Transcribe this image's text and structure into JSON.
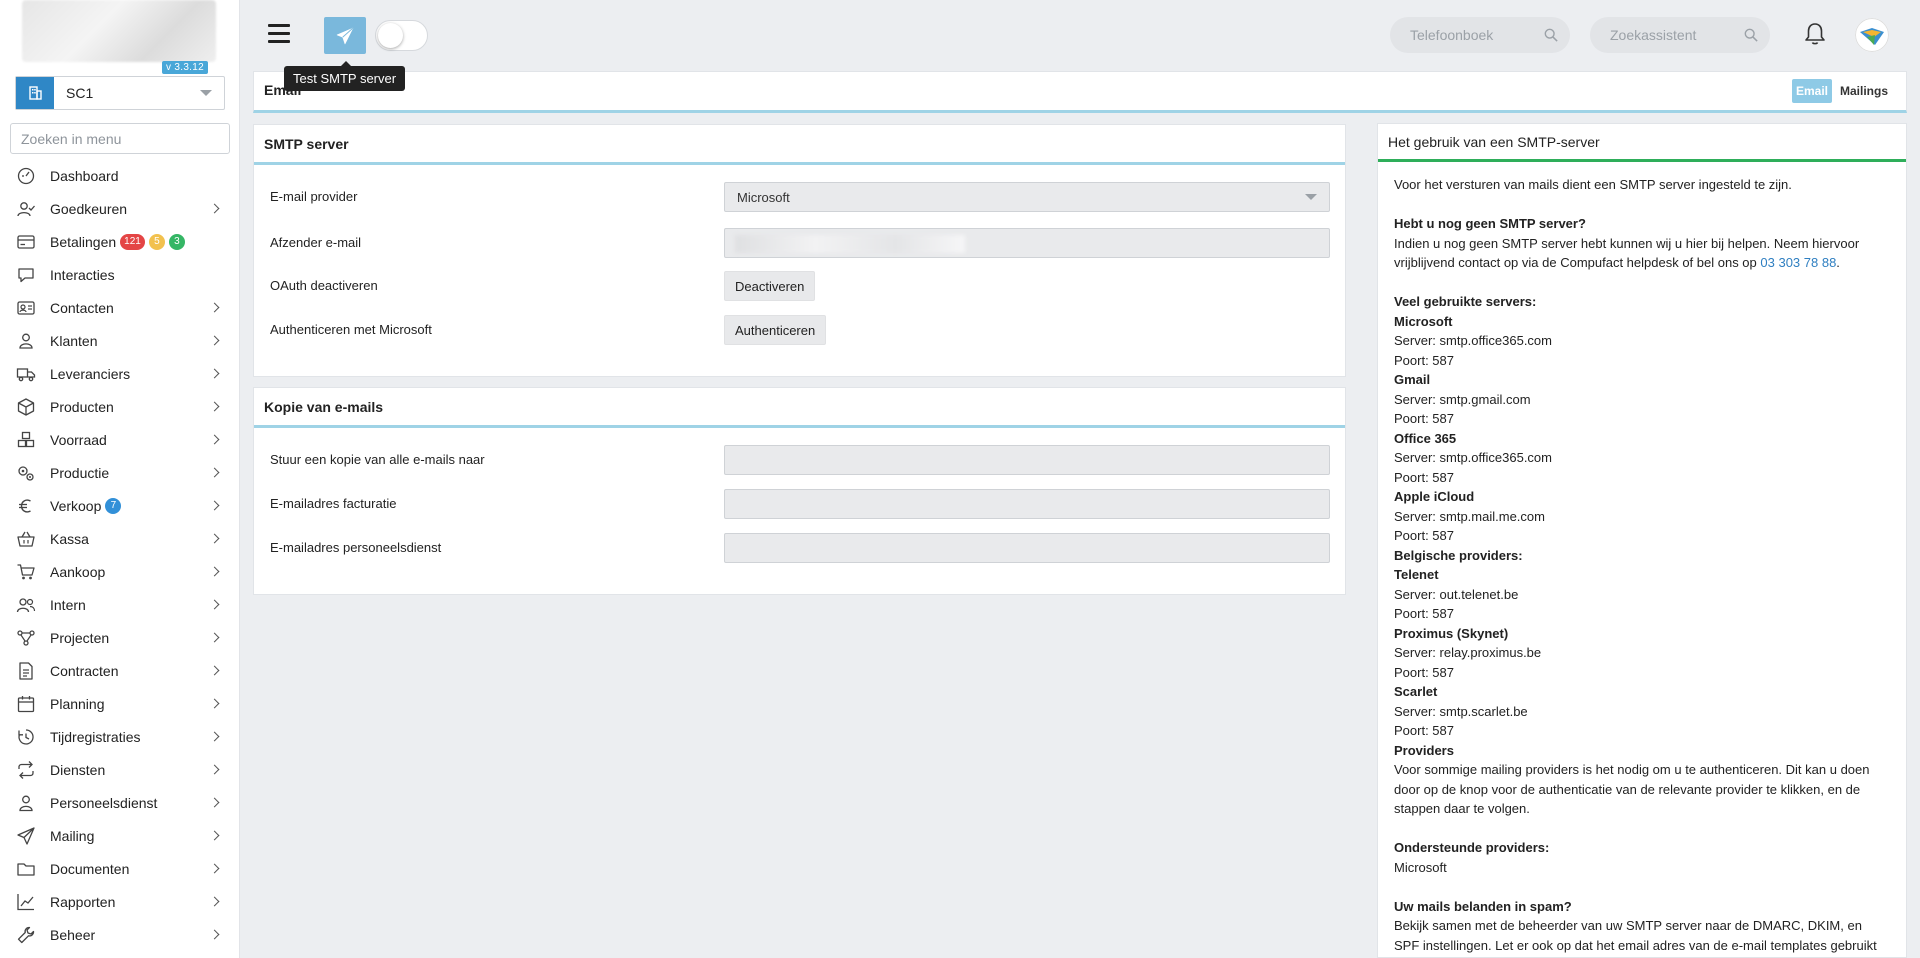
{
  "sidebar": {
    "version": "v 3.3.12",
    "company": "SC1",
    "search_placeholder": "Zoeken in menu",
    "items": [
      {
        "label": "Dashboard",
        "icon": "dashboard-icon",
        "chevron": false
      },
      {
        "label": "Goedkeuren",
        "icon": "user-check-icon",
        "chevron": true
      },
      {
        "label": "Betalingen",
        "icon": "credit-card-icon",
        "chevron": false,
        "badges": [
          {
            "text": "121",
            "color": "red"
          },
          {
            "text": "5",
            "color": "yellow"
          },
          {
            "text": "3",
            "color": "green"
          }
        ]
      },
      {
        "label": "Interacties",
        "icon": "chat-icon",
        "chevron": false
      },
      {
        "label": "Contacten",
        "icon": "contact-card-icon",
        "chevron": true
      },
      {
        "label": "Klanten",
        "icon": "customer-icon",
        "chevron": true
      },
      {
        "label": "Leveranciers",
        "icon": "truck-icon",
        "chevron": true
      },
      {
        "label": "Producten",
        "icon": "box-icon",
        "chevron": true
      },
      {
        "label": "Voorraad",
        "icon": "boxes-icon",
        "chevron": true
      },
      {
        "label": "Productie",
        "icon": "gears-icon",
        "chevron": true
      },
      {
        "label": "Verkoop",
        "icon": "euro-icon",
        "chevron": true,
        "badges": [
          {
            "text": "7",
            "color": "blue"
          }
        ]
      },
      {
        "label": "Kassa",
        "icon": "basket-icon",
        "chevron": true
      },
      {
        "label": "Aankoop",
        "icon": "cart-icon",
        "chevron": true
      },
      {
        "label": "Intern",
        "icon": "users-icon",
        "chevron": true
      },
      {
        "label": "Projecten",
        "icon": "project-icon",
        "chevron": true
      },
      {
        "label": "Contracten",
        "icon": "contract-icon",
        "chevron": true
      },
      {
        "label": "Planning",
        "icon": "calendar-icon",
        "chevron": true
      },
      {
        "label": "Tijdregistraties",
        "icon": "clock-history-icon",
        "chevron": true
      },
      {
        "label": "Diensten",
        "icon": "repeat-icon",
        "chevron": true
      },
      {
        "label": "Personeelsdienst",
        "icon": "person-badge-icon",
        "chevron": true
      },
      {
        "label": "Mailing",
        "icon": "send-icon",
        "chevron": true
      },
      {
        "label": "Documenten",
        "icon": "folder-icon",
        "chevron": true
      },
      {
        "label": "Rapporten",
        "icon": "chart-line-icon",
        "chevron": true
      },
      {
        "label": "Beheer",
        "icon": "wrench-icon",
        "chevron": true
      }
    ]
  },
  "topbar": {
    "tooltip": "Test SMTP server",
    "phonebook_placeholder": "Telefoonboek",
    "assistant_placeholder": "Zoekassistent"
  },
  "page": {
    "title": "Email",
    "tabs": [
      {
        "label": "Email",
        "active": true
      },
      {
        "label": "Mailings",
        "active": false
      }
    ]
  },
  "smtp": {
    "title": "SMTP server",
    "provider_label": "E-mail provider",
    "provider_value": "Microsoft",
    "sender_label": "Afzender e-mail",
    "oauth_label": "OAuth deactiveren",
    "oauth_button": "Deactiveren",
    "auth_label": "Authenticeren met Microsoft",
    "auth_button": "Authenticeren"
  },
  "copy": {
    "title": "Kopie van e-mails",
    "copy_all_label": "Stuur een kopie van alle e-mails naar",
    "billing_label": "E-mailadres facturatie",
    "hr_label": "E-mailadres personeelsdienst"
  },
  "help": {
    "title": "Het gebruik van een SMTP-server",
    "intro": "Voor het versturen van mails dient een SMTP server ingesteld te zijn.",
    "no_server_heading": "Hebt u nog geen SMTP server?",
    "no_server_text": "Indien u nog geen SMTP server hebt kunnen wij u hier bij helpen. Neem hiervoor vrijblijvend contact op via de Compufact helpdesk of bel ons op ",
    "phone": "03 303 78 88",
    "phone_suffix": ".",
    "common_heading": "Veel gebruikte servers:",
    "servers": [
      {
        "name": "Microsoft",
        "server": "Server: smtp.office365.com",
        "port": "Poort: 587"
      },
      {
        "name": "Gmail",
        "server": "Server: smtp.gmail.com",
        "port": "Poort: 587"
      },
      {
        "name": "Office 365",
        "server": "Server: smtp.office365.com",
        "port": "Poort: 587"
      },
      {
        "name": "Apple iCloud",
        "server": "Server: smtp.mail.me.com",
        "port": "Poort: 587"
      }
    ],
    "belgian_heading": "Belgische providers:",
    "belgian_servers": [
      {
        "name": "Telenet",
        "server": "Server: out.telenet.be",
        "port": "Poort: 587"
      },
      {
        "name": "Proximus (Skynet)",
        "server": "Server: relay.proximus.be",
        "port": "Poort: 587"
      },
      {
        "name": "Scarlet",
        "server": "Server: smtp.scarlet.be",
        "port": "Poort: 587"
      }
    ],
    "providers_heading": "Providers",
    "providers_text": "Voor sommige mailing providers is het nodig om u te authenticeren. Dit kan u doen door op de knop voor de authenticatie van de relevante provider te klikken, en de stappen daar te volgen.",
    "supported_heading": "Ondersteunde providers:",
    "supported_value": "Microsoft",
    "spam_heading": "Uw mails belanden in spam?",
    "spam_text": "Bekijk samen met de beheerder van uw SMTP server naar de DMARC, DKIM, en SPF instellingen. Let er ook op dat het email adres van de e-mail templates gebruikt kan"
  }
}
